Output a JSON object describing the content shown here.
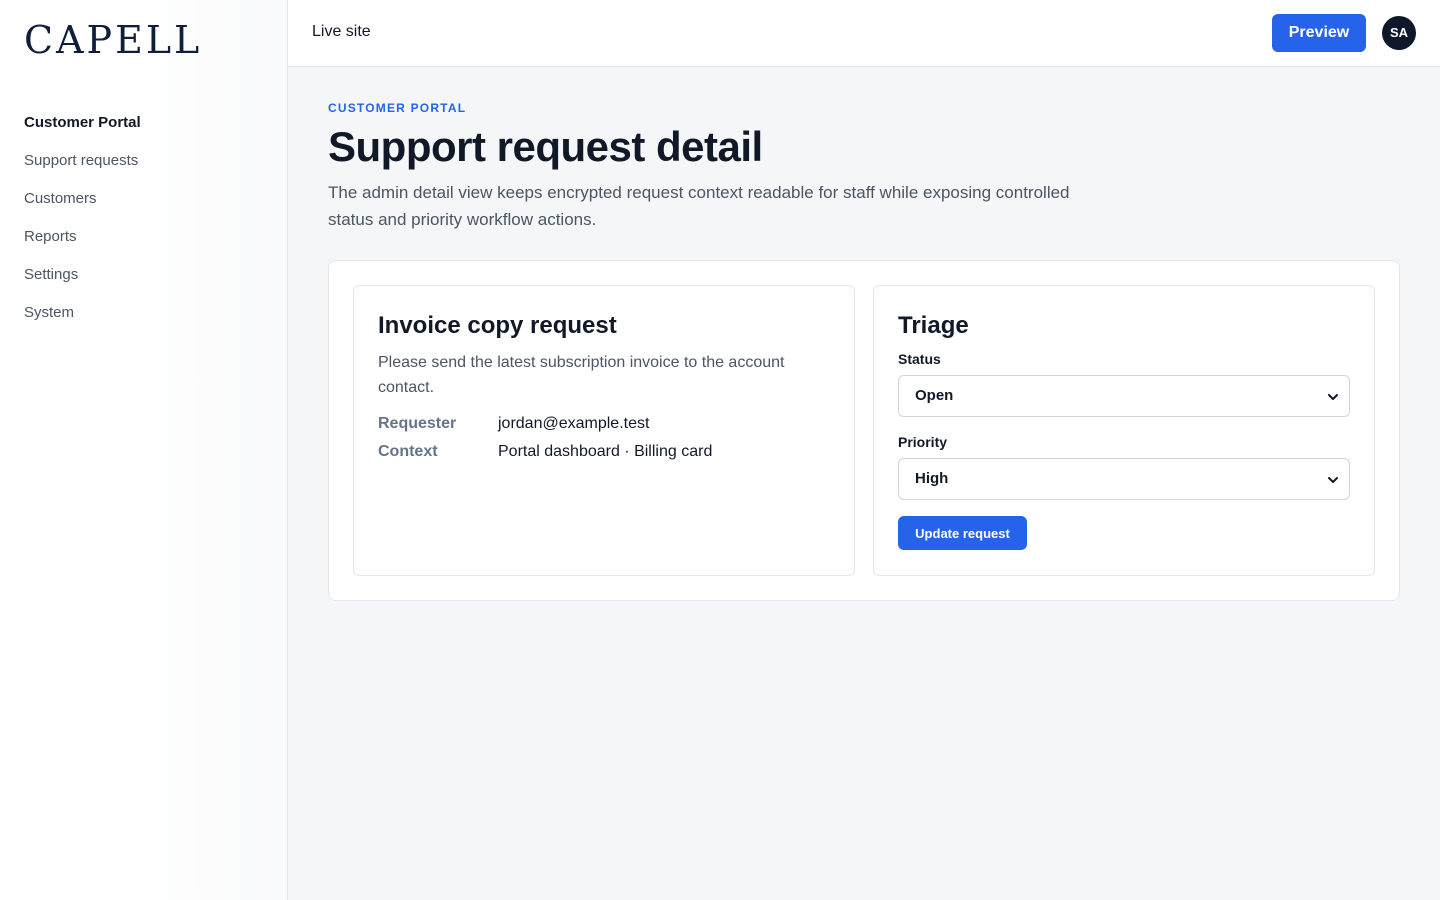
{
  "brand": {
    "logo_text": "CAPELL"
  },
  "sidebar": {
    "items": [
      {
        "label": "Customer Portal",
        "active": true
      },
      {
        "label": "Support requests",
        "active": false
      },
      {
        "label": "Customers",
        "active": false
      },
      {
        "label": "Reports",
        "active": false
      },
      {
        "label": "Settings",
        "active": false
      },
      {
        "label": "System",
        "active": false
      }
    ]
  },
  "topbar": {
    "live_site_label": "Live site",
    "preview_label": "Preview",
    "avatar_initials": "SA"
  },
  "page": {
    "eyebrow": "CUSTOMER PORTAL",
    "title": "Support request detail",
    "description": "The admin detail view keeps encrypted request context readable for staff while exposing controlled status and priority workflow actions."
  },
  "request": {
    "title": "Invoice copy request",
    "message": "Please send the latest subscription invoice to the account contact.",
    "fields": [
      {
        "label": "Requester",
        "value": "jordan@example.test"
      },
      {
        "label": "Context",
        "value": "Portal dashboard · Billing card"
      }
    ]
  },
  "triage": {
    "title": "Triage",
    "status_label": "Status",
    "status_value": "Open",
    "priority_label": "Priority",
    "priority_value": "High",
    "update_label": "Update request"
  },
  "colors": {
    "accent": "#2563eb",
    "brand_navy": "#0f1e3a",
    "avatar_bg": "#0f172a"
  },
  "icons": {
    "select_chevron": "chevron-down-icon"
  }
}
